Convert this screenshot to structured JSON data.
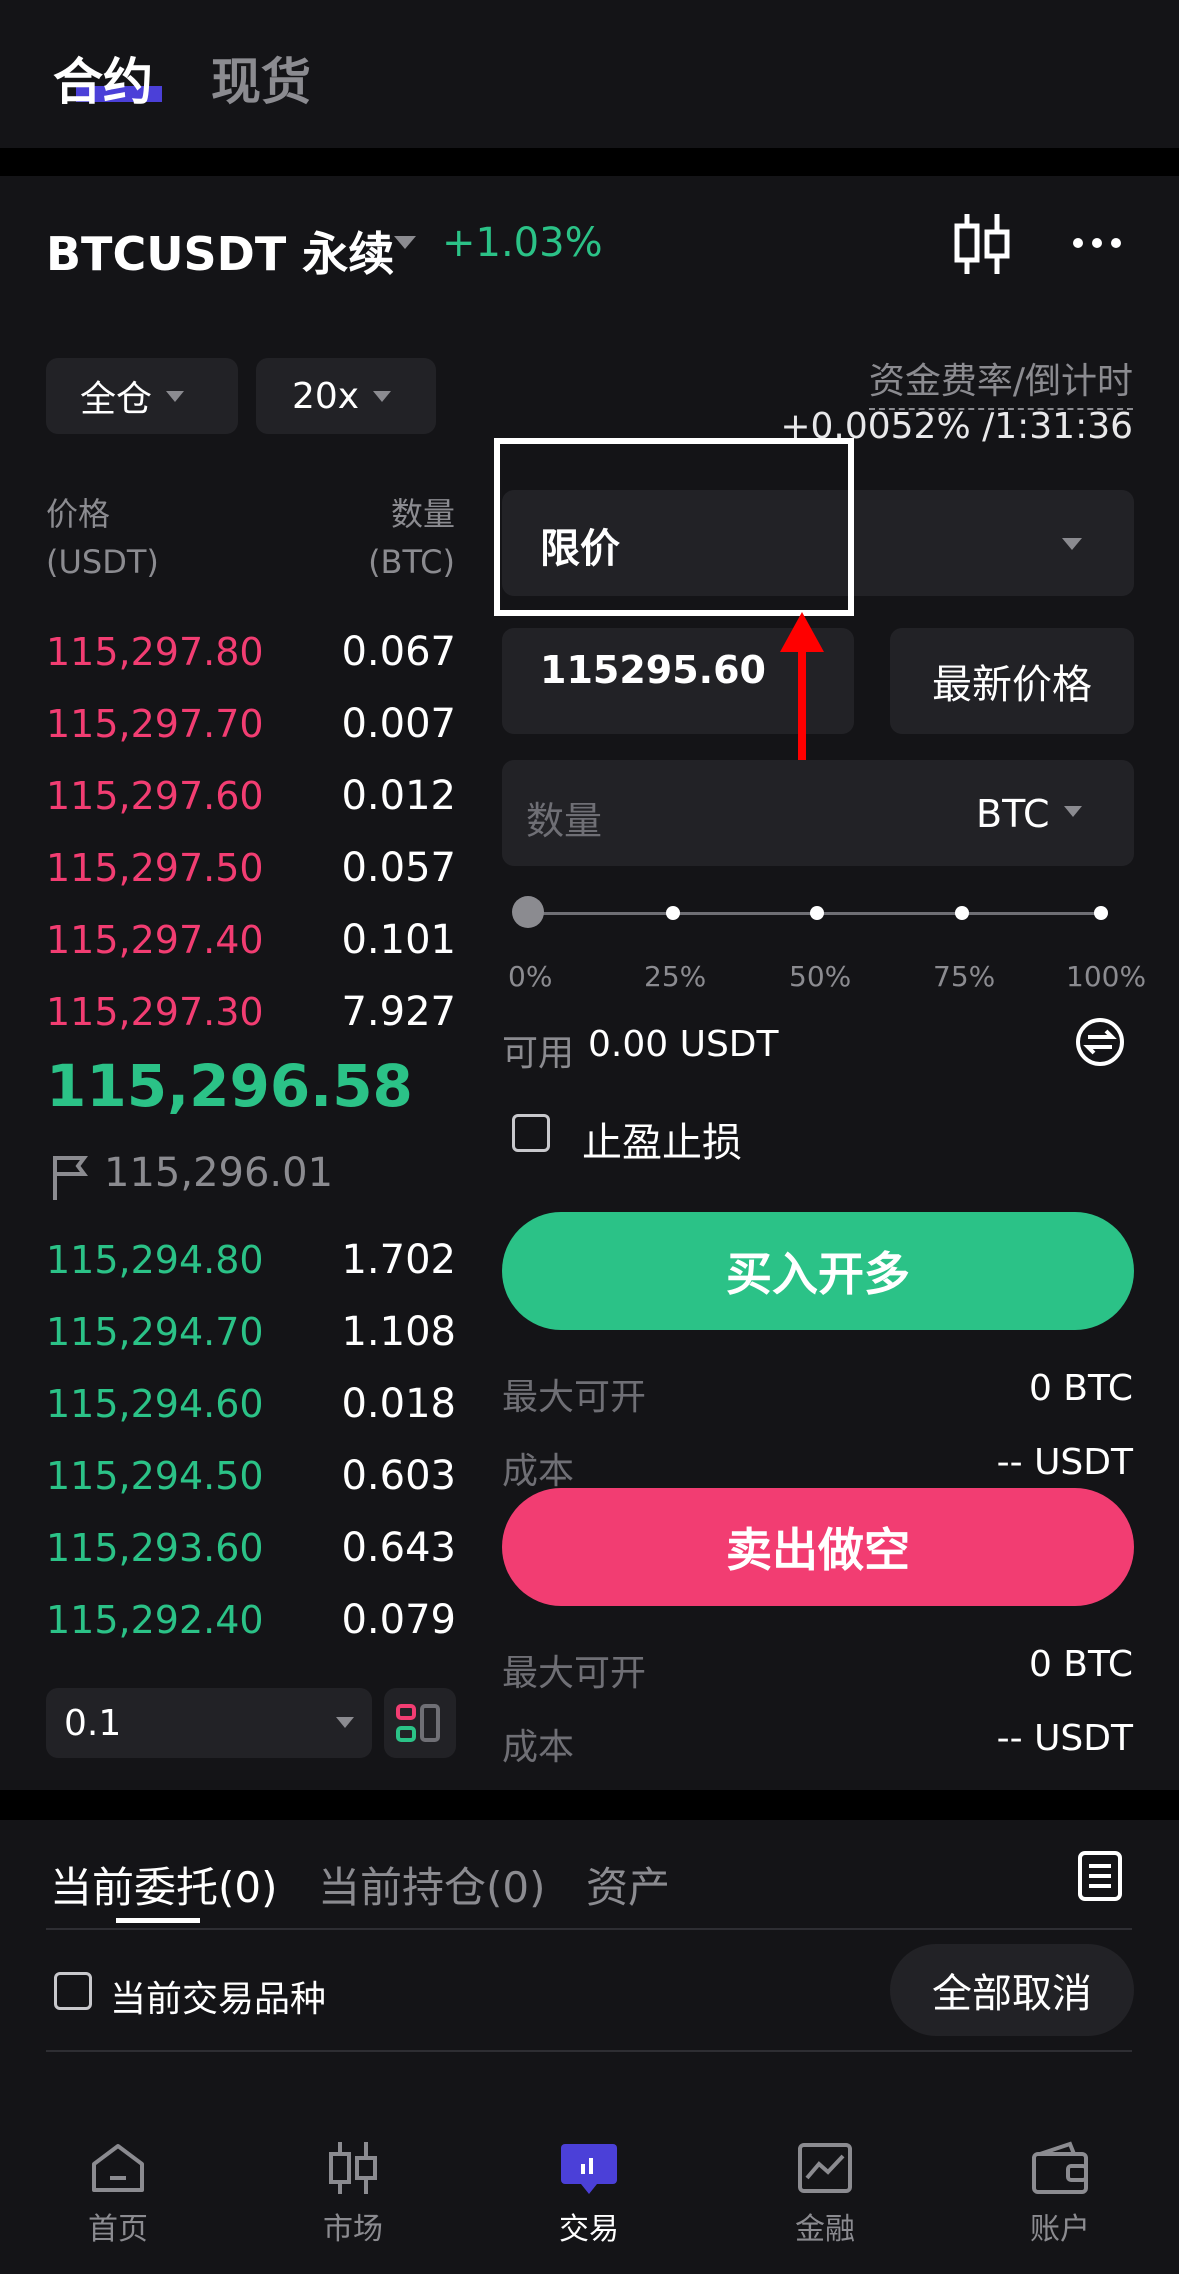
{
  "top_tabs": {
    "futures": "合约",
    "spot": "现货"
  },
  "header": {
    "symbol": "BTCUSDT 永续",
    "change": "+1.03%"
  },
  "margin": {
    "mode": "全仓",
    "leverage": "20x"
  },
  "funding": {
    "label": "资金费率/倒计时",
    "value": "+0.0052% /1:31:36"
  },
  "orderbook": {
    "price_label": "价格",
    "price_unit": "(USDT)",
    "qty_label": "数量",
    "qty_unit": "(BTC)",
    "asks": [
      {
        "price": "115,297.80",
        "qty": "0.067"
      },
      {
        "price": "115,297.70",
        "qty": "0.007"
      },
      {
        "price": "115,297.60",
        "qty": "0.012"
      },
      {
        "price": "115,297.50",
        "qty": "0.057"
      },
      {
        "price": "115,297.40",
        "qty": "0.101"
      },
      {
        "price": "115,297.30",
        "qty": "7.927"
      }
    ],
    "last_price": "115,296.58",
    "mark_price": "115,296.01",
    "bids": [
      {
        "price": "115,294.80",
        "qty": "1.702"
      },
      {
        "price": "115,294.70",
        "qty": "1.108"
      },
      {
        "price": "115,294.60",
        "qty": "0.018"
      },
      {
        "price": "115,294.50",
        "qty": "0.603"
      },
      {
        "price": "115,293.60",
        "qty": "0.643"
      },
      {
        "price": "115,292.40",
        "qty": "0.079"
      }
    ],
    "depth": "0.1"
  },
  "order_form": {
    "order_type": "限价",
    "price": "115295.60",
    "latest_price_button": "最新价格",
    "qty_placeholder": "数量",
    "qty_unit": "BTC",
    "slider": {
      "value": 0,
      "marks": [
        "0%",
        "25%",
        "50%",
        "75%",
        "100%"
      ]
    },
    "available_label": "可用",
    "available_value": "0.00 USDT",
    "tpsl_label": "止盈止损",
    "buy_button": "买入开多",
    "sell_button": "卖出做空",
    "buy_max_label": "最大可开",
    "buy_max_value": "0 BTC",
    "buy_cost_label": "成本",
    "buy_cost_value": "-- USDT",
    "sell_max_label": "最大可开",
    "sell_max_value": "0 BTC",
    "sell_cost_label": "成本",
    "sell_cost_value": "-- USDT"
  },
  "bottom_tabs": {
    "open_orders": "当前委托(0)",
    "positions": "当前持仓(0)",
    "assets": "资产"
  },
  "filter": {
    "current_symbol_label": "当前交易品种",
    "cancel_all": "全部取消"
  },
  "nav": [
    {
      "label": "首页",
      "icon": "home-icon"
    },
    {
      "label": "市场",
      "icon": "candlestick-icon"
    },
    {
      "label": "交易",
      "icon": "trade-icon"
    },
    {
      "label": "金融",
      "icon": "finance-chart-icon"
    },
    {
      "label": "账户",
      "icon": "wallet-icon"
    }
  ],
  "colors": {
    "up": "#2bc287",
    "down": "#f23d72",
    "accent": "#4b40d8",
    "background": "#141417"
  }
}
